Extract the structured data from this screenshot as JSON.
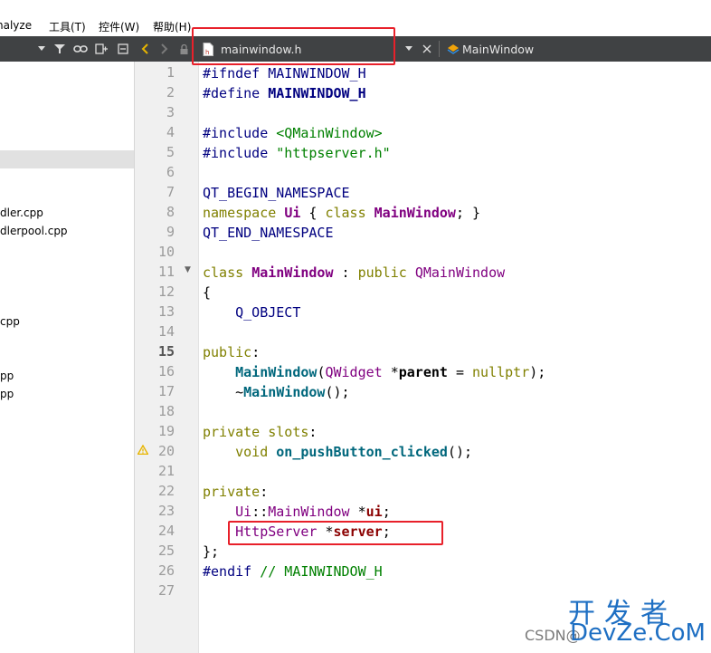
{
  "menu": [
    {
      "label": "nalyze"
    },
    {
      "label": "工具(T)"
    },
    {
      "label": "控件(W)"
    },
    {
      "label": "帮助(H)"
    }
  ],
  "editor_tab": {
    "filename": "mainwindow.h",
    "symbol": "MainWindow"
  },
  "sidebar": {
    "items": [
      "dler.cpp",
      "dlerpool.cpp",
      "cpp",
      "pp",
      "pp"
    ]
  },
  "line_numbers": [
    "1",
    "2",
    "3",
    "4",
    "5",
    "6",
    "7",
    "8",
    "9",
    "10",
    "11",
    "12",
    "13",
    "14",
    "15",
    "16",
    "17",
    "18",
    "19",
    "20",
    "21",
    "22",
    "23",
    "24",
    "25",
    "26",
    "27"
  ],
  "current_line": "15",
  "code": {
    "l1": {
      "a": "#ifndef ",
      "b": "MAINWINDOW_H"
    },
    "l2": {
      "a": "#define ",
      "b": "MAINWINDOW_H"
    },
    "l4": {
      "a": "#include ",
      "b": "<QMainWindow>"
    },
    "l5": {
      "a": "#include ",
      "b": "\"httpserver.h\""
    },
    "l7": {
      "a": "QT_BEGIN_NAMESPACE"
    },
    "l8": {
      "a": "namespace ",
      "b": "Ui",
      "c": " { ",
      "d": "class ",
      "e": "MainWindow",
      "f": "; }"
    },
    "l9": {
      "a": "QT_END_NAMESPACE"
    },
    "l11": {
      "a": "class ",
      "b": "MainWindow",
      "c": " : ",
      "d": "public ",
      "e": "QMainWindow"
    },
    "l12": {
      "a": "{"
    },
    "l13": {
      "a": "    ",
      "b": "Q_OBJECT"
    },
    "l15": {
      "a": "public",
      "b": ":"
    },
    "l16": {
      "a": "    ",
      "b": "MainWindow",
      "c": "(",
      "d": "QWidget",
      "e": " *",
      "f": "parent",
      "g": " = ",
      "h": "nullptr",
      "i": ");"
    },
    "l17": {
      "a": "    ~",
      "b": "MainWindow",
      "c": "();"
    },
    "l19": {
      "a": "private slots",
      "b": ":"
    },
    "l20": {
      "a": "    ",
      "b": "void ",
      "c": "on_pushButton_clicked",
      "d": "();"
    },
    "l22": {
      "a": "private",
      "b": ":"
    },
    "l23": {
      "a": "    ",
      "b": "Ui",
      "c": "::",
      "d": "MainWindow",
      "e": " *",
      "f": "ui",
      "g": ";"
    },
    "l24": {
      "a": "    ",
      "b": "HttpServer",
      "c": " *",
      "d": "server",
      "e": ";"
    },
    "l25": {
      "a": "};"
    },
    "l26": {
      "a": "#endif ",
      "b": "// MAINWINDOW_H"
    }
  },
  "watermark": {
    "cn": "开发者",
    "csdn": "CSDN@",
    "brand": "DevZe.CoM"
  },
  "colors": {
    "toolbar_bg": "#404244",
    "highlight_red": "#e8202a",
    "gutter_bg": "#f0f0f0"
  },
  "icons": [
    "dropdown-arrow-icon",
    "filter-icon",
    "link-icon",
    "split-icon",
    "close-split-icon",
    "back-arrow-icon",
    "forward-arrow-icon",
    "lock-icon",
    "header-file-icon",
    "close-icon",
    "class-icon",
    "warning-icon",
    "fold-arrow-icon"
  ]
}
